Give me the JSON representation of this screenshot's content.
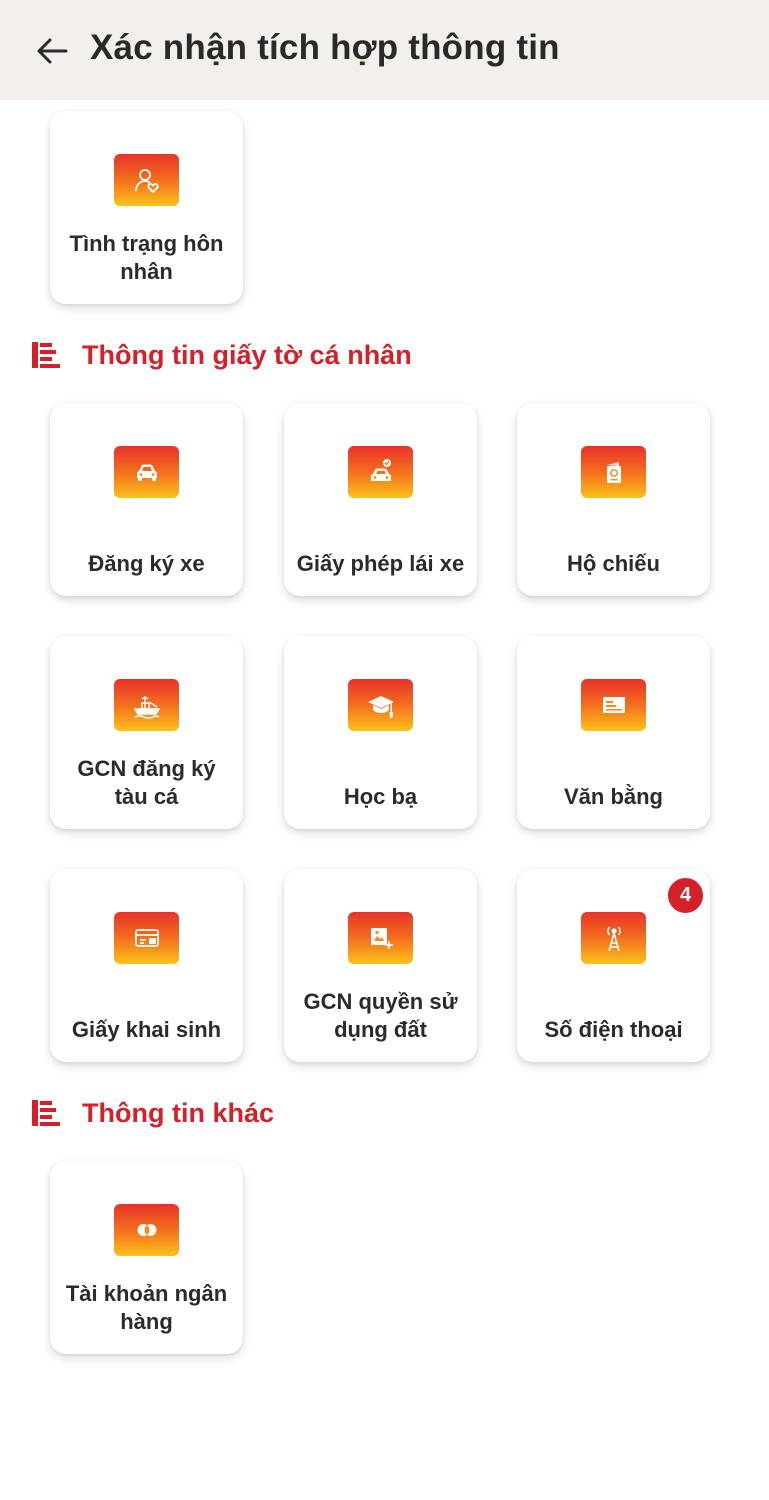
{
  "header": {
    "title": "Xác nhận tích hợp thông tin",
    "back_icon": "arrow-left-icon"
  },
  "colors": {
    "accent": "#d5202a",
    "header_bg": "#f3efea",
    "icon_gradient_top": "#e8322a",
    "icon_gradient_bottom": "#fbc21b"
  },
  "top_items": [
    {
      "label": "Tình trạng hôn nhân",
      "icon": "marriage-status-icon"
    }
  ],
  "sections": [
    {
      "title": "Thông tin giấy tờ cá nhân",
      "icon": "list-icon",
      "items": [
        {
          "label": "Đăng ký xe",
          "icon": "car-icon"
        },
        {
          "label": "Giấy phép lái xe",
          "icon": "driver-license-icon"
        },
        {
          "label": "Hộ chiếu",
          "icon": "passport-icon"
        },
        {
          "label": "GCN đăng ký tàu cá",
          "icon": "fishing-boat-icon"
        },
        {
          "label": "Học bạ",
          "icon": "graduation-cap-icon"
        },
        {
          "label": "Văn bằng",
          "icon": "diploma-icon"
        },
        {
          "label": "Giấy khai sinh",
          "icon": "birth-certificate-icon"
        },
        {
          "label": "GCN quyền sử dụng đất",
          "icon": "land-certificate-icon"
        },
        {
          "label": "Số điện thoại",
          "icon": "phone-tower-icon",
          "badge": "4"
        }
      ]
    },
    {
      "title": "Thông tin khác",
      "icon": "list-icon",
      "items": [
        {
          "label": "Tài khoản ngân hàng",
          "icon": "bank-account-icon"
        }
      ]
    }
  ]
}
